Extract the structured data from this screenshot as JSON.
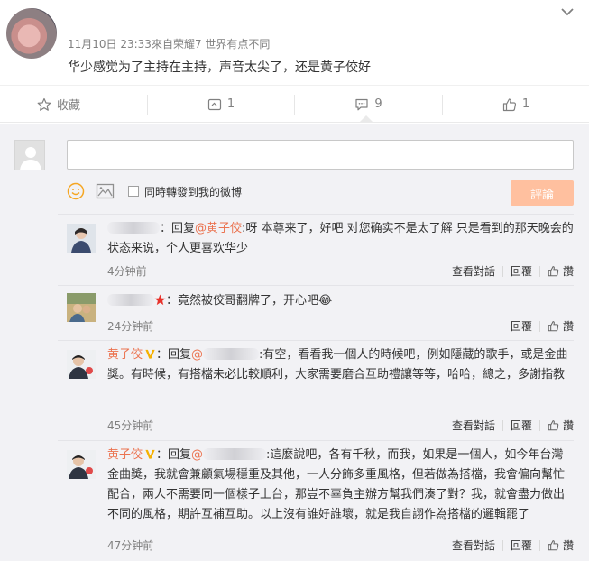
{
  "post": {
    "meta_date": "11月10日 23:33",
    "meta_from": "來自",
    "meta_source": "荣耀7 世界有点不同",
    "text": "华少感觉为了主持在主持，声音太尖了，还是黄子佼好"
  },
  "actions": {
    "favorite_label": "收藏",
    "repost_count": "1",
    "comment_count": "9",
    "like_count": "1"
  },
  "composer": {
    "input_value": "",
    "also_repost_label": "同時轉發到我的微博",
    "submit_label": "評論"
  },
  "comments": [
    {
      "prefix": "：回复",
      "mention": "@黄子佼",
      "text": ":呀 本尊来了，好吧 对您确实不是太了解 只是看到的那天晚会的状态来说，个人更喜欢华少",
      "time": "4分钟前",
      "view_thread": "查看對話",
      "reply": "回覆",
      "like": "讚"
    },
    {
      "text": "：竟然被佼哥翻牌了，开心吧",
      "emoji": "😂",
      "time": "24分钟前",
      "reply": "回覆",
      "like": "讚"
    },
    {
      "name": "黄子佼",
      "prefix": "：回复",
      "mention": "@",
      "text": ":有空，看看我一個人的時候吧，例如隱藏的歌手，或是金曲獎。有時候，有搭檔未必比較順利，大家需要磨合互助禮讓等等，哈哈，總之，多謝指教",
      "time": "45分钟前",
      "view_thread": "查看對話",
      "reply": "回覆",
      "like": "讚"
    },
    {
      "name": "黄子佼",
      "prefix": "：回复",
      "mention": "@",
      "text": ":這麼說吧，各有千秋，而我，如果是一個人，如今年台灣金曲獎，我就會兼顧氣場穩重及其他，一人分飾多重風格，但若做為搭檔，我會偏向幫忙配合，兩人不需要同一個樣子上台，那豈不辜負主辦方幫我們湊了對？我，就會盡力做出不同的風格，期許互補互助。以上沒有誰好誰壞，就是我自詡作為搭檔的邏輯罷了",
      "time": "47分钟前",
      "view_thread": "查看對話",
      "reply": "回覆",
      "like": "讚"
    }
  ],
  "colors": {
    "accent": "#eb7350",
    "submit_disabled": "#ffc09f",
    "panel_bg": "#f2f2f5"
  },
  "icons": [
    "chevron-down-icon",
    "star-outline-icon",
    "repost-icon",
    "comment-icon",
    "thumbs-up-icon",
    "smiley-icon",
    "image-icon",
    "verified-v-icon",
    "red-star-icon"
  ]
}
